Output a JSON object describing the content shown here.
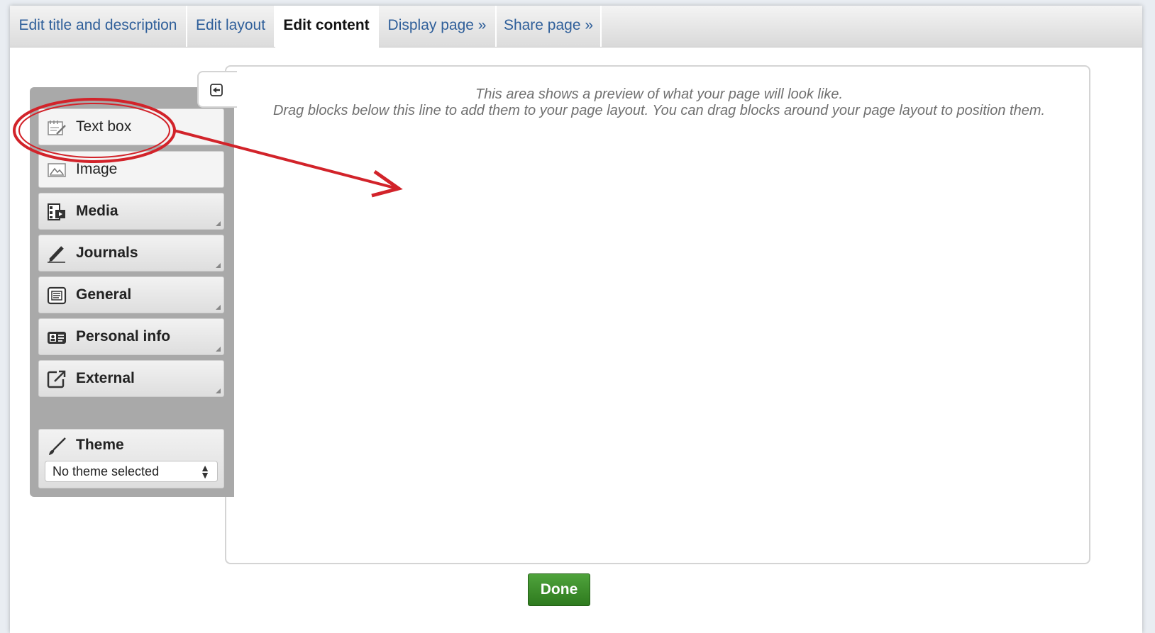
{
  "tabs": [
    {
      "label": "Edit title and description"
    },
    {
      "label": "Edit layout"
    },
    {
      "label": "Edit content"
    },
    {
      "label": "Display page »"
    },
    {
      "label": "Share page »"
    }
  ],
  "active_tab": "Edit content",
  "sidebar": {
    "blocks": [
      {
        "label": "Text box",
        "icon": "text-box-icon"
      },
      {
        "label": "Image",
        "icon": "image-icon"
      },
      {
        "label": "Media",
        "icon": "media-icon"
      },
      {
        "label": "Journals",
        "icon": "pen-icon"
      },
      {
        "label": "General",
        "icon": "document-icon"
      },
      {
        "label": "Personal info",
        "icon": "id-card-icon"
      },
      {
        "label": "External",
        "icon": "external-link-icon"
      }
    ],
    "theme": {
      "label": "Theme",
      "icon": "brush-icon",
      "selected": "No theme selected"
    }
  },
  "preview": {
    "line1": "This area shows a preview of what your page will look like.",
    "line2": "Drag blocks below this line to add them to your page layout. You can drag blocks around your page layout to position them."
  },
  "done_label": "Done",
  "colors": {
    "tab_text": "#2f5f9a",
    "done_green": "#3c8c2a",
    "annotation_red": "#d2232a",
    "sidebar_bg": "#a9a9a9"
  }
}
